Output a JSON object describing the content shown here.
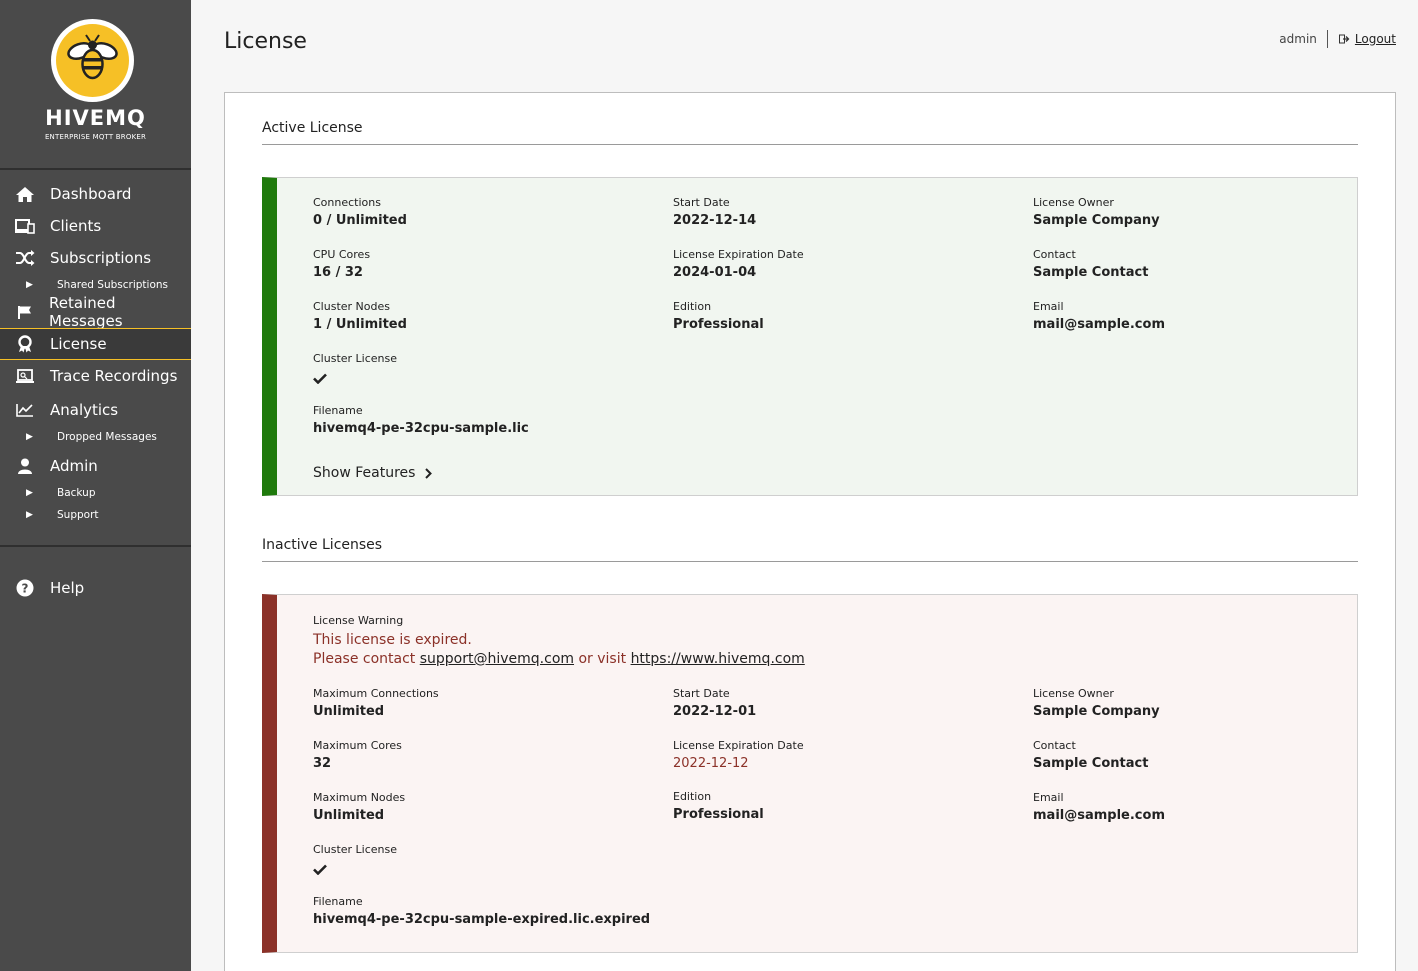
{
  "brand": {
    "name": "HIVEMQ",
    "tagline": "ENTERPRISE MQTT BROKER"
  },
  "sidebar": {
    "items": [
      {
        "label": "Dashboard",
        "icon": "home-icon"
      },
      {
        "label": "Clients",
        "icon": "devices-icon"
      },
      {
        "label": "Subscriptions",
        "icon": "shuffle-icon"
      },
      {
        "label": "Shared Subscriptions",
        "sub": true
      },
      {
        "label": "Retained Messages",
        "icon": "flag-icon"
      },
      {
        "label": "License",
        "icon": "award-icon",
        "active": true
      },
      {
        "label": "Trace Recordings",
        "icon": "laptop-icon"
      },
      {
        "label": "Analytics",
        "icon": "chart-line-icon"
      },
      {
        "label": "Dropped Messages",
        "sub": true
      },
      {
        "label": "Admin",
        "icon": "user-icon"
      },
      {
        "label": "Backup",
        "sub": true
      },
      {
        "label": "Support",
        "sub": true
      }
    ],
    "help_label": "Help"
  },
  "header": {
    "title": "License",
    "username": "admin",
    "logout_label": "Logout"
  },
  "active": {
    "section_title": "Active License",
    "connections_label": "Connections",
    "connections": "0 / Unlimited",
    "cpu_label": "CPU Cores",
    "cpu": "16 / 32",
    "nodes_label": "Cluster Nodes",
    "nodes": "1 / Unlimited",
    "cluster_label": "Cluster License",
    "filename_label": "Filename",
    "filename": "hivemq4-pe-32cpu-sample.lic",
    "start_label": "Start Date",
    "start": "2022-12-14",
    "expiry_label": "License Expiration Date",
    "expiry": "2024-01-04",
    "edition_label": "Edition",
    "edition": "Professional",
    "owner_label": "License Owner",
    "owner": "Sample Company",
    "contact_label": "Contact",
    "contact": "Sample Contact",
    "email_label": "Email",
    "email": "mail@sample.com",
    "show_features": "Show Features"
  },
  "inactive": {
    "section_title": "Inactive Licenses",
    "warning_label": "License Warning",
    "warning_line1": "This license is expired.",
    "warning_pre": "Please contact ",
    "warning_email": "support@hivemq.com",
    "warning_mid": " or visit ",
    "warning_url": "https://www.hivemq.com",
    "max_conn_label": "Maximum Connections",
    "max_conn": "Unlimited",
    "max_cores_label": "Maximum Cores",
    "max_cores": "32",
    "max_nodes_label": "Maximum Nodes",
    "max_nodes": "Unlimited",
    "cluster_label": "Cluster License",
    "filename_label": "Filename",
    "filename": "hivemq4-pe-32cpu-sample-expired.lic.expired",
    "start_label": "Start Date",
    "start": "2022-12-01",
    "expiry_label": "License Expiration Date",
    "expiry": "2022-12-12",
    "edition_label": "Edition",
    "edition": "Professional",
    "owner_label": "License Owner",
    "owner": "Sample Company",
    "contact_label": "Contact",
    "contact": "Sample Contact",
    "email_label": "Email",
    "email": "mail@sample.com"
  },
  "colors": {
    "sidebar": "#4a4a4a",
    "accent": "#f6c026",
    "active_green": "#1f7a0c",
    "inactive_red": "#8b3128"
  }
}
